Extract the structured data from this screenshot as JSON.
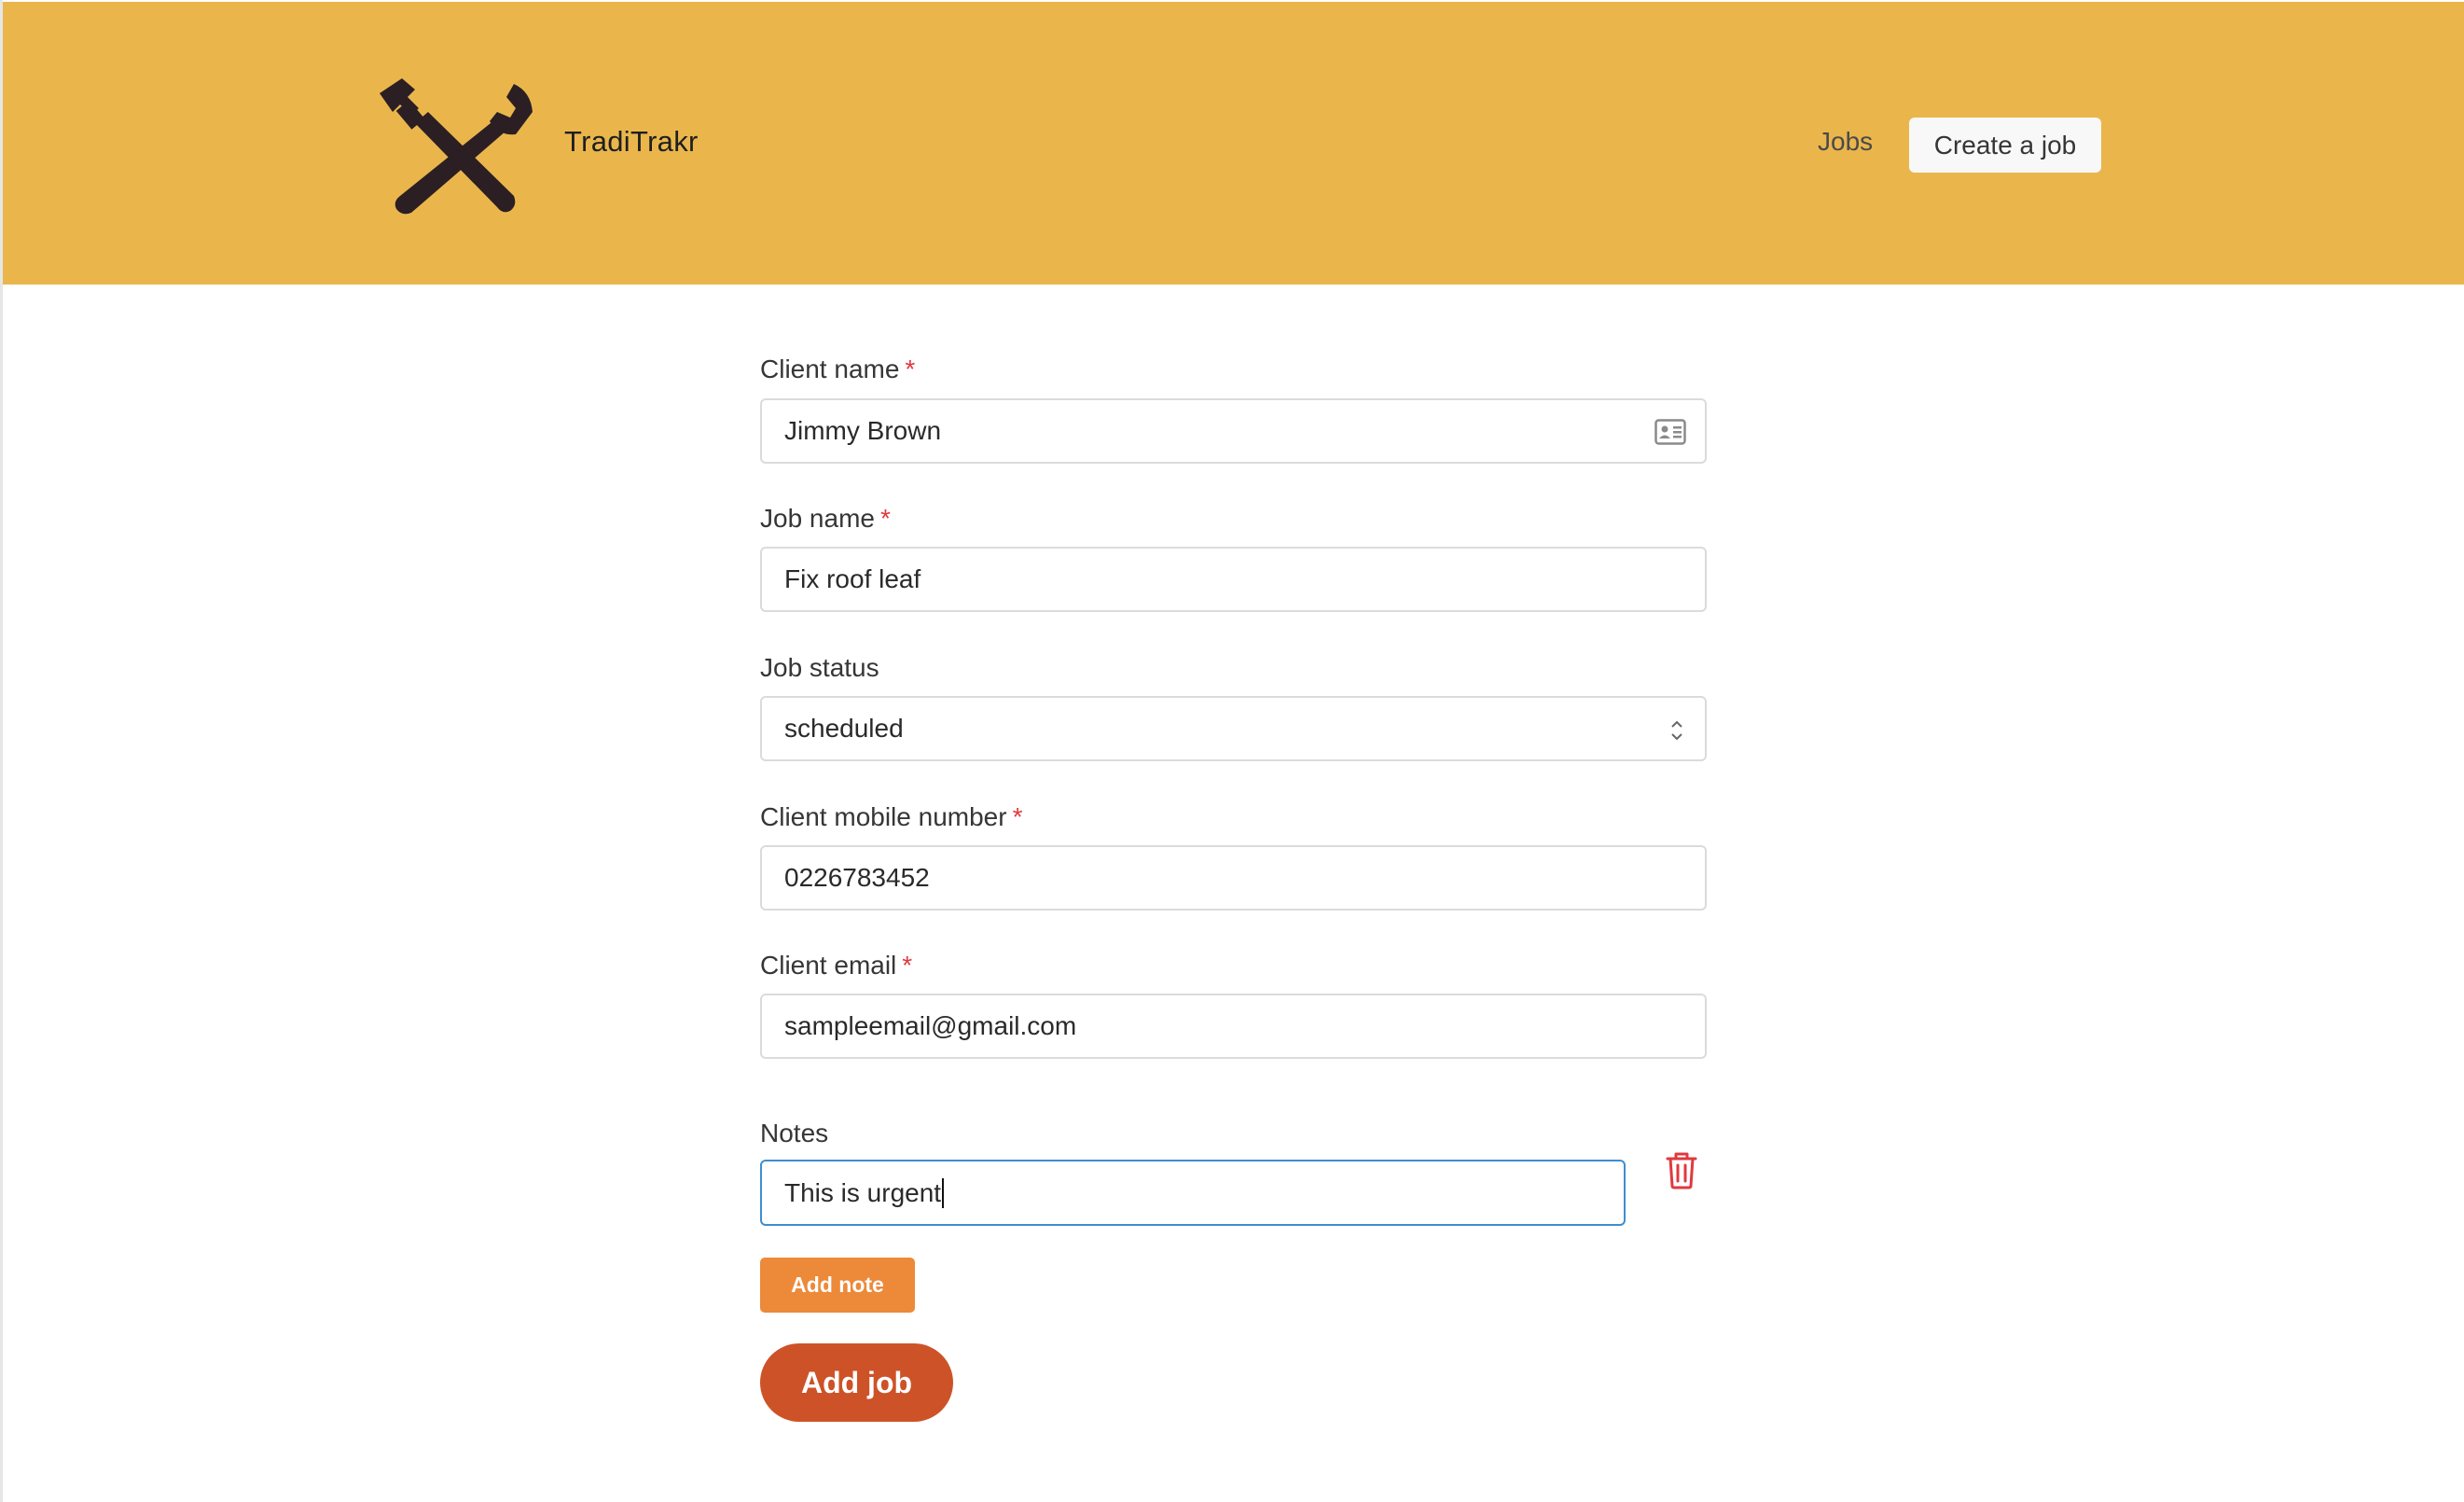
{
  "app": {
    "brand_name": "TradiTrakr",
    "logo_icon": "wrench-and-pipe-wrench-icon",
    "header_color": "#eab64c"
  },
  "nav": {
    "jobs_label": "Jobs",
    "create_job_label": "Create a job"
  },
  "form": {
    "required_marker": "*",
    "client_name": {
      "label": "Client name",
      "value": "Jimmy Brown",
      "required": true,
      "icon": "contact-card-icon"
    },
    "job_name": {
      "label": "Job name",
      "value": "Fix roof leaf",
      "required": true
    },
    "job_status": {
      "label": "Job status",
      "value": "scheduled",
      "required": false
    },
    "client_mobile": {
      "label": "Client mobile number",
      "value": "0226783452",
      "required": true
    },
    "client_email": {
      "label": "Client email",
      "value": "sampleemail@gmail.com",
      "required": true
    },
    "notes": {
      "label": "Notes",
      "items": [
        "This is urgent"
      ]
    },
    "add_note_label": "Add note",
    "submit_label": "Add job"
  },
  "colors": {
    "required": "#e0393e",
    "add_note_button": "#ec8a3a",
    "add_job_button": "#cd5228",
    "focus_border": "#3e8ed0",
    "trash_icon": "#e0393e"
  }
}
